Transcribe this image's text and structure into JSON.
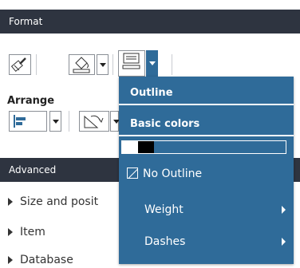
{
  "panel": {
    "format_title": "Format",
    "arrange_label": "Arrange",
    "advanced_title": "Advanced"
  },
  "advanced_items": [
    "Size and posit",
    "Item",
    "Database"
  ],
  "menu": {
    "outline_title": "Outline",
    "basic_colors_title": "Basic colors",
    "no_outline": "No Outline",
    "weight": "Weight",
    "dashes": "Dashes"
  },
  "colors": {
    "header_bg": "#2e3440",
    "menu_bg": "#2f6b99",
    "swatches": [
      "#ffffff",
      "#000000"
    ]
  },
  "icons": [
    "format-painter-icon",
    "fill-bucket-icon",
    "outline-icon",
    "align-left-icon",
    "rotate-icon"
  ]
}
